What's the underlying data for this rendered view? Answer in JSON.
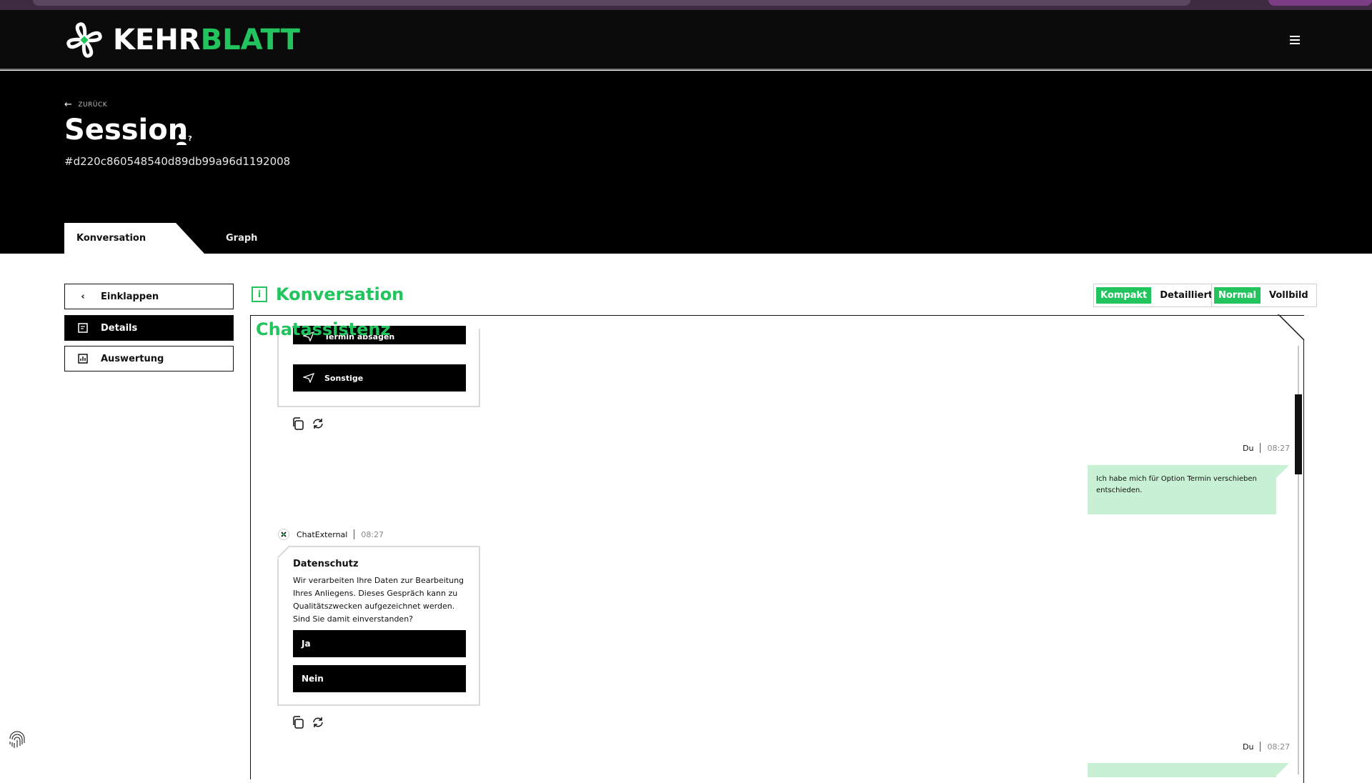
{
  "app": {
    "logo_white": "KEHR",
    "logo_green": "BLATT",
    "brand_green": "#21c45d"
  },
  "header": {
    "back_label": "ZURÜCK",
    "title": "Session",
    "session_id": "#d220c860548540d89db99a96d1192008",
    "title_icon": "user-question-icon",
    "menu_icon": "hamburger-menu-icon"
  },
  "tabs": [
    {
      "label": "Konversation",
      "active": true
    },
    {
      "label": "Graph",
      "active": false
    }
  ],
  "sidebar": {
    "collapse_label": "Einklappen",
    "details_label": "Details",
    "evaluation_label": "Auswertung"
  },
  "conversation": {
    "title": "Konversation",
    "panel_label": "Chatassistenz",
    "view_toggle": {
      "compact": "Kompakt",
      "detailed": "Detailliert"
    },
    "size_toggle": {
      "normal": "Normal",
      "full": "Vollbild"
    }
  },
  "messages": {
    "card1_btn_partial": "Termin absagen",
    "card1_btn_other": "Sonstige",
    "user_msg1": {
      "sender": "Du",
      "time": "08:27",
      "text": "Ich habe mich für Option Termin verschieben entschieden."
    },
    "bot_msg": {
      "sender": "ChatExternal",
      "time": "08:27",
      "title": "Datenschutz",
      "text": "Wir verarbeiten Ihre Daten zur Bearbeitung Ihres Anliegens. Dieses Gespräch kann zu Qualitätszwecken aufgezeichnet werden. Sind Sie damit einverstanden?",
      "yes": "Ja",
      "no": "Nein"
    },
    "user_msg2": {
      "sender": "Du",
      "time": "08:27"
    }
  }
}
